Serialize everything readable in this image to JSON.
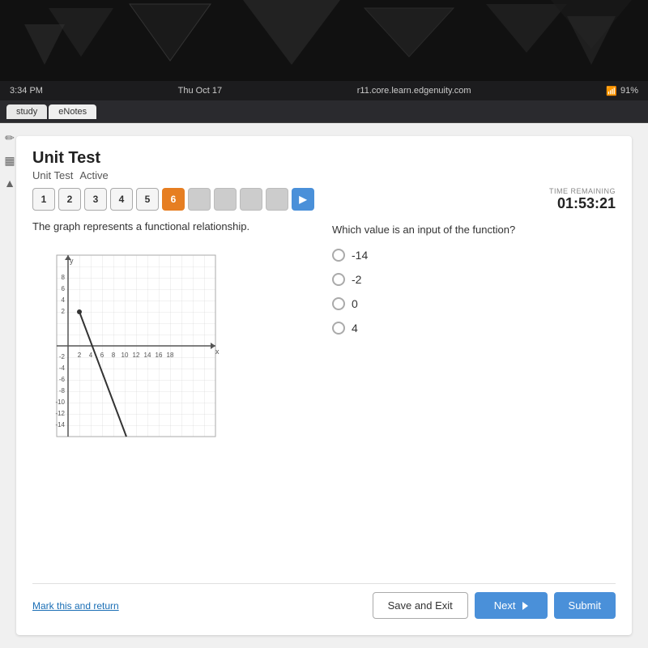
{
  "deco": {
    "bg_color": "#111"
  },
  "status_bar": {
    "time": "3:34 PM",
    "day": "Thu Oct 17",
    "url": "r11.core.learn.edgenuity.com",
    "signal": "91%"
  },
  "tabs": [
    {
      "label": "study",
      "active": false
    },
    {
      "label": "eNotes",
      "active": true
    }
  ],
  "card": {
    "title": "Unit Test",
    "subtitle_label": "Unit Test",
    "status": "Active",
    "time_remaining_label": "TIME REMAINING",
    "time_remaining": "01:53:21",
    "question_numbers": [
      {
        "num": "1",
        "state": "normal"
      },
      {
        "num": "2",
        "state": "normal"
      },
      {
        "num": "3",
        "state": "normal"
      },
      {
        "num": "4",
        "state": "normal"
      },
      {
        "num": "5",
        "state": "normal"
      },
      {
        "num": "6",
        "state": "active"
      },
      {
        "num": "",
        "state": "locked"
      },
      {
        "num": "",
        "state": "locked"
      },
      {
        "num": "",
        "state": "locked"
      },
      {
        "num": "",
        "state": "locked"
      },
      {
        "num": "▶",
        "state": "arrow"
      }
    ],
    "graph_prompt": "The graph represents a functional relationship.",
    "answer_prompt": "Which value is an input of the function?",
    "options": [
      {
        "value": "-14",
        "selected": false
      },
      {
        "value": "-2",
        "selected": false
      },
      {
        "value": "0",
        "selected": false
      },
      {
        "value": "4",
        "selected": false
      }
    ],
    "mark_return": "Mark this and return",
    "btn_save_exit": "Save and Exit",
    "btn_next": "Next",
    "btn_submit": "Submit"
  },
  "sidebar_icons": [
    {
      "name": "pencil-icon",
      "symbol": "✏"
    },
    {
      "name": "calculator-icon",
      "symbol": "▦"
    },
    {
      "name": "arrow-up-icon",
      "symbol": "▲"
    }
  ]
}
